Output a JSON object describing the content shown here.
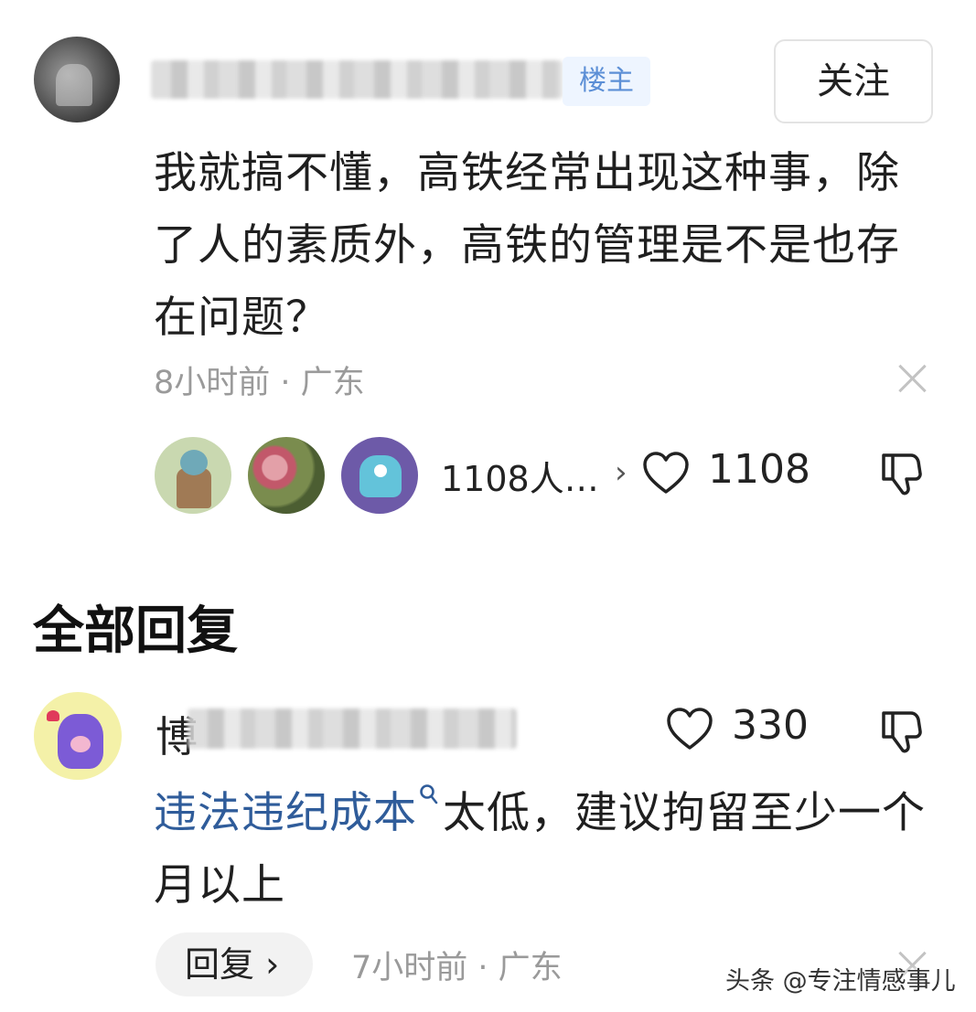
{
  "main_comment": {
    "author_badge": "楼主",
    "follow_label": "关注",
    "text": "我就搞不懂，高铁经常出现这种事，除了人的素质外，高铁的管理是不是也存在问题？",
    "meta": "8小时前 · 广东",
    "likers_text": "1108人…",
    "likers_chevron": "›",
    "like_count": "1108"
  },
  "replies": {
    "section_title": "全部回复",
    "items": [
      {
        "name_visible": "博",
        "like_count": "330",
        "text_link": "违法违纪成本",
        "text_rest": "太低，建议拘留至少一个月以上",
        "reply_label": "回复 ›",
        "meta": "7小时前 · 广东"
      }
    ]
  },
  "watermark": "头条 @专注情感事儿",
  "icons": {
    "heart": "heart-icon",
    "dislike": "thumbs-down-icon",
    "close": "close-icon",
    "search": "search-icon"
  },
  "colors": {
    "link": "#2f5c9a",
    "meta": "#9a9a9a",
    "badge_bg": "#eef5ff",
    "badge_text": "#5c8fd6"
  }
}
